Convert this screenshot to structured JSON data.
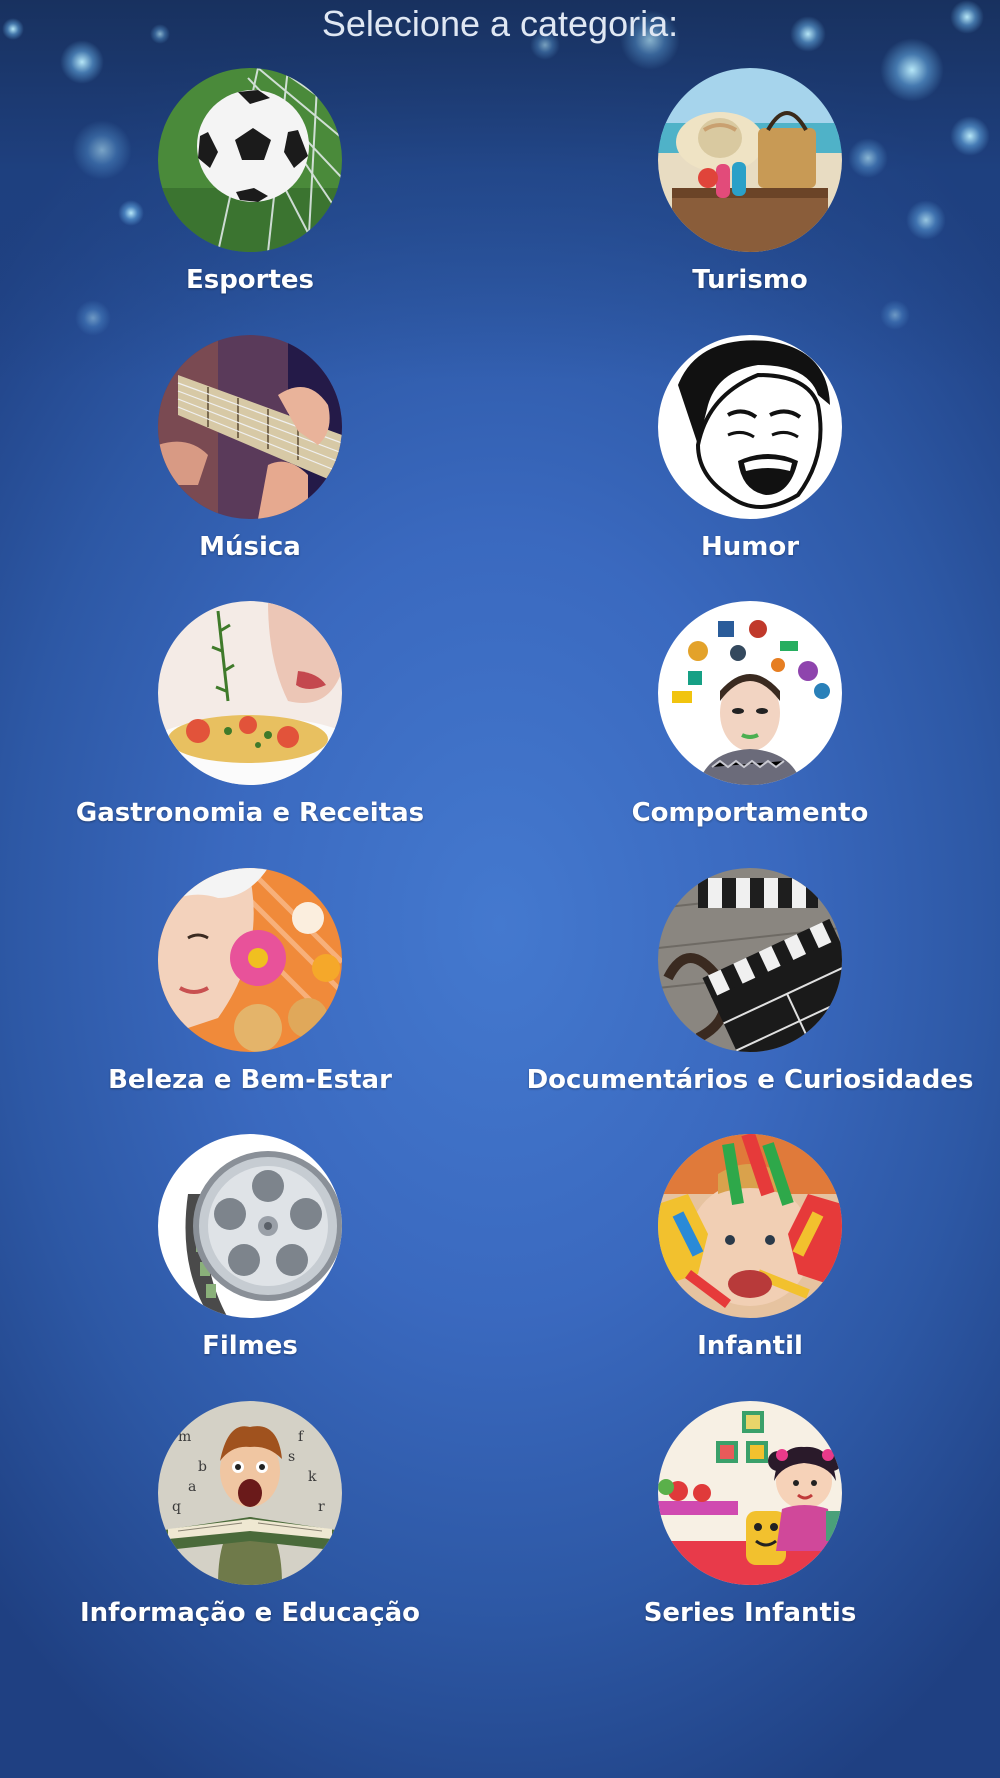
{
  "header": {
    "title": "Selecione a categoria:"
  },
  "categories": [
    {
      "label": "Esportes",
      "icon": "soccer-ball-icon"
    },
    {
      "label": "Turismo",
      "icon": "beach-suitcase-icon"
    },
    {
      "label": "Música",
      "icon": "guitar-icon"
    },
    {
      "label": "Humor",
      "icon": "laughing-face-icon"
    },
    {
      "label": "Gastronomia e Receitas",
      "icon": "food-plate-icon"
    },
    {
      "label": "Comportamento",
      "icon": "mind-objects-icon"
    },
    {
      "label": "Beleza e Bem-Estar",
      "icon": "spa-woman-icon"
    },
    {
      "label": "Documentários e Curiosidades",
      "icon": "clapperboard-icon"
    },
    {
      "label": "Filmes",
      "icon": "film-reel-icon"
    },
    {
      "label": "Infantil",
      "icon": "painted-hands-child-icon"
    },
    {
      "label": "Informação e Educação",
      "icon": "boy-reading-book-icon"
    },
    {
      "label": "Series Infantis",
      "icon": "cartoon-girl-icon"
    }
  ],
  "colors": {
    "background": "#3a69bf",
    "text": "#ffffff",
    "title": "#dfe7f3"
  }
}
